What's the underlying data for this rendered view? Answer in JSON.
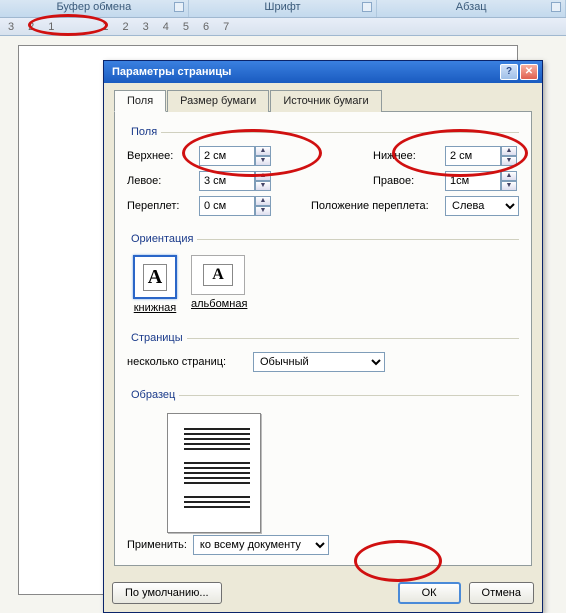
{
  "ribbon": {
    "groups": [
      "Буфер обмена",
      "Шрифт",
      "Абзац"
    ]
  },
  "ruler": [
    "3",
    "2",
    "1",
    "1",
    "2",
    "3",
    "4",
    "5",
    "6",
    "7"
  ],
  "dialog": {
    "title": "Параметры страницы",
    "tabs": {
      "fields": "Поля",
      "paper": "Размер бумаги",
      "source": "Источник бумаги"
    },
    "sections": {
      "fields": "Поля",
      "orientation": "Ориентация",
      "pages": "Страницы",
      "sample": "Образец"
    },
    "margins": {
      "top_label": "Верхнее:",
      "top_value": "2 см",
      "bottom_label": "Нижнее:",
      "bottom_value": "2 см",
      "left_label": "Левое:",
      "left_value": "3 см",
      "right_label": "Правое:",
      "right_value": "1см",
      "gutter_label": "Переплет:",
      "gutter_value": "0 см",
      "gutter_pos_label": "Положение переплета:",
      "gutter_pos_value": "Слева"
    },
    "orientation": {
      "portrait": "книжная",
      "landscape": "альбомная",
      "glyph": "А"
    },
    "pages": {
      "multi_label": "несколько страниц:",
      "multi_value": "Обычный"
    },
    "apply": {
      "label": "Применить:",
      "value": "ко всему документу"
    },
    "buttons": {
      "default": "По умолчанию...",
      "ok": "ОК",
      "cancel": "Отмена"
    }
  }
}
